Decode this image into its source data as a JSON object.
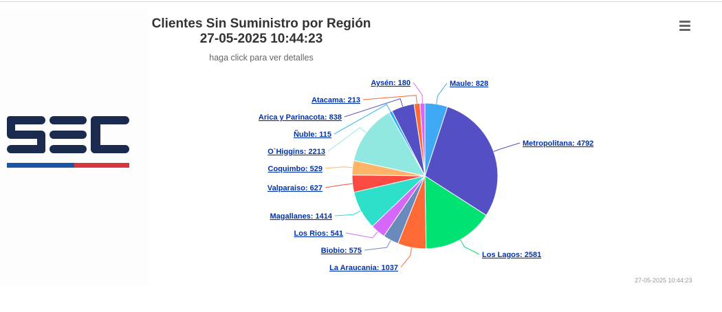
{
  "title": "Clientes Sin Suministro por Región",
  "date_title": "27-05-2025 10:44:23",
  "subtitle": "haga click para ver detalles",
  "credits": "27-05-2025 10:44:23",
  "logo": {
    "text": "SEC",
    "colors": [
      "#1b2b4f",
      "#1a56a6",
      "#d8353c"
    ]
  },
  "menu_icon": "hamburger-menu-icon",
  "chart_data": {
    "type": "pie",
    "title": "Clientes Sin Suministro por Región",
    "subtitle": "haga click para ver detalles",
    "start": "Maule",
    "direction": "clockwise",
    "slices": [
      {
        "name": "Maule",
        "value": 828,
        "label": "Maule: 828",
        "color": "#3fa9f5"
      },
      {
        "name": "Metropolitana",
        "value": 4792,
        "label": "Metropolitana: 4792",
        "color": "#544fc5"
      },
      {
        "name": "Los Lagos",
        "value": 2581,
        "label": "Los Lagos: 2581",
        "color": "#00e272"
      },
      {
        "name": "La Araucania",
        "value": 1037,
        "label": "La Araucania: 1037",
        "color": "#fe6a35"
      },
      {
        "name": "Biobio",
        "value": 575,
        "label": "Biobio: 575",
        "color": "#6b8abc"
      },
      {
        "name": "Los Rios",
        "value": 541,
        "label": "Los Rios: 541",
        "color": "#d568fb"
      },
      {
        "name": "Magallanes",
        "value": 1414,
        "label": "Magallanes: 1414",
        "color": "#2ee0ca"
      },
      {
        "name": "Valparaiso",
        "value": 627,
        "label": "Valparaiso: 627",
        "color": "#fa4b42"
      },
      {
        "name": "Coquimbo",
        "value": 529,
        "label": "Coquimbo: 529",
        "color": "#feb56a"
      },
      {
        "name": "O`Higgins",
        "value": 2213,
        "label": "O`Higgins: 2213",
        "color": "#91e8e1"
      },
      {
        "name": "Ñuble",
        "value": 115,
        "label": "Ñuble: 115",
        "color": "#2caffe"
      },
      {
        "name": "Arica y Parinacota",
        "value": 838,
        "label": "Arica y Parinacota: 838",
        "color": "#544fc5"
      },
      {
        "name": "Atacama",
        "value": 213,
        "label": "Atacama: 213",
        "color": "#fe6a35"
      },
      {
        "name": "Aysén",
        "value": 180,
        "label": "Aysén: 180",
        "color": "#d568fb"
      }
    ]
  }
}
